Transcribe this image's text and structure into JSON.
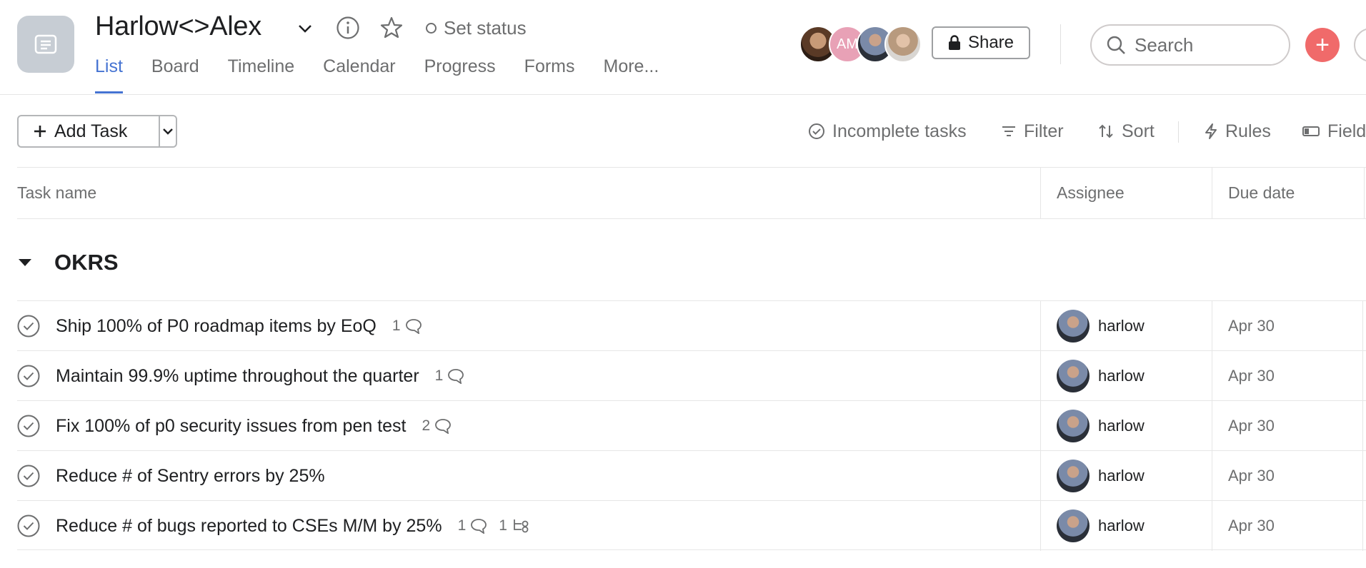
{
  "project": {
    "title": "Harlow<>Alex",
    "set_status": "Set status"
  },
  "tabs": [
    {
      "label": "List",
      "active": true
    },
    {
      "label": "Board",
      "active": false
    },
    {
      "label": "Timeline",
      "active": false
    },
    {
      "label": "Calendar",
      "active": false
    },
    {
      "label": "Progress",
      "active": false
    },
    {
      "label": "Forms",
      "active": false
    },
    {
      "label": "More...",
      "active": false
    }
  ],
  "members": {
    "avatar_initials": "AM"
  },
  "header": {
    "share_label": "Share",
    "search_placeholder": "Search",
    "add_symbol": "+"
  },
  "toolbar": {
    "add_task_label": "Add Task",
    "incomplete_label": "Incomplete tasks",
    "filter_label": "Filter",
    "sort_label": "Sort",
    "rules_label": "Rules",
    "fields_label": "Field"
  },
  "columns": {
    "task": "Task name",
    "assignee": "Assignee",
    "due": "Due date"
  },
  "section": {
    "title": "OKRS"
  },
  "tasks": [
    {
      "name": "Ship 100% of P0 roadmap items by EoQ",
      "comments": "1",
      "subtasks": "",
      "assignee": "harlow",
      "due": "Apr 30"
    },
    {
      "name": "Maintain 99.9% uptime throughout the quarter",
      "comments": "1",
      "subtasks": "",
      "assignee": "harlow",
      "due": "Apr 30"
    },
    {
      "name": "Fix 100% of p0 security issues from pen test",
      "comments": "2",
      "subtasks": "",
      "assignee": "harlow",
      "due": "Apr 30"
    },
    {
      "name": "Reduce # of Sentry errors by 25%",
      "comments": "",
      "subtasks": "",
      "assignee": "harlow",
      "due": "Apr 30"
    },
    {
      "name": "Reduce # of bugs reported to CSEs M/M by 25%",
      "comments": "1",
      "subtasks": "1",
      "assignee": "harlow",
      "due": "Apr 30"
    }
  ],
  "colors": {
    "accent": "#4573d2",
    "add_button": "#f06a6a",
    "muted_text": "#6d6e6f"
  }
}
